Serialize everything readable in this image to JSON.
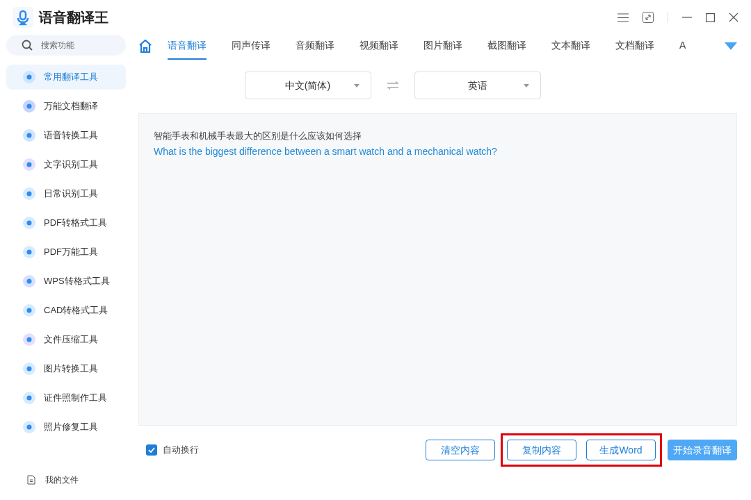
{
  "app": {
    "title": "语音翻译王"
  },
  "sidebar": {
    "search": {
      "placeholder": "搜索功能"
    },
    "items": [
      {
        "label": "常用翻译工具",
        "selected": true
      },
      {
        "label": "万能文档翻译",
        "selected": false
      },
      {
        "label": "语音转换工具",
        "selected": false
      },
      {
        "label": "文字识别工具",
        "selected": false
      },
      {
        "label": "日常识别工具",
        "selected": false
      },
      {
        "label": "PDF转格式工具",
        "selected": false
      },
      {
        "label": "PDF万能工具",
        "selected": false
      },
      {
        "label": "WPS转格式工具",
        "selected": false
      },
      {
        "label": "CAD转格式工具",
        "selected": false
      },
      {
        "label": "文件压缩工具",
        "selected": false
      },
      {
        "label": "图片转换工具",
        "selected": false
      },
      {
        "label": "证件照制作工具",
        "selected": false
      },
      {
        "label": "照片修复工具",
        "selected": false
      }
    ],
    "footer": {
      "label": "我的文件"
    }
  },
  "tabs": [
    {
      "label": "语音翻译",
      "selected": true
    },
    {
      "label": "同声传译",
      "selected": false
    },
    {
      "label": "音频翻译",
      "selected": false
    },
    {
      "label": "视频翻译",
      "selected": false
    },
    {
      "label": "图片翻译",
      "selected": false
    },
    {
      "label": "截图翻译",
      "selected": false
    },
    {
      "label": "文本翻译",
      "selected": false
    },
    {
      "label": "文档翻译",
      "selected": false
    },
    {
      "label": "A",
      "selected": false
    }
  ],
  "languages": {
    "source": "中文(简体)",
    "target": "英语"
  },
  "content": {
    "source_text": "智能手表和机械手表最大的区别是什么应该如何选择",
    "translation": "What is the biggest difference between a smart watch and a mechanical watch?"
  },
  "footer": {
    "auto_wrap": {
      "label": "自动换行",
      "checked": true
    },
    "buttons": [
      {
        "label": "清空内容",
        "kind": "outline",
        "highlighted": false
      },
      {
        "label": "复制内容",
        "kind": "outline",
        "highlighted": true
      },
      {
        "label": "生成Word",
        "kind": "outline",
        "highlighted": true
      },
      {
        "label": "开始录音翻译",
        "kind": "primary",
        "highlighted": false
      }
    ]
  }
}
